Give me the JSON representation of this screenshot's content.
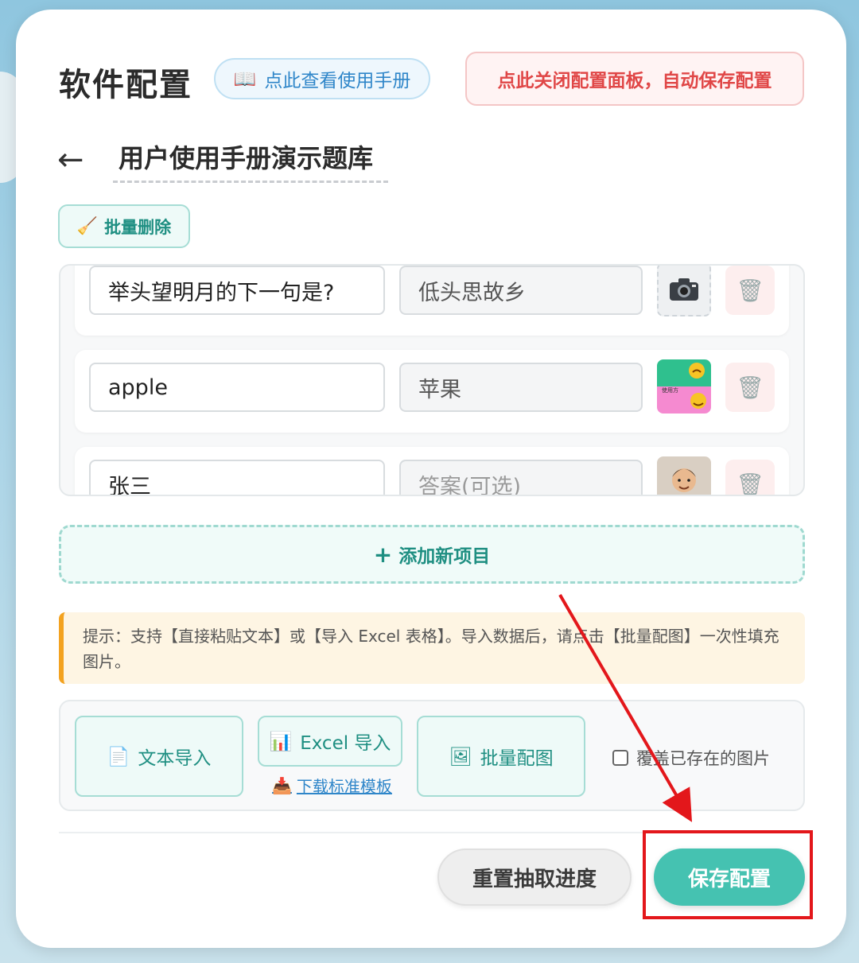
{
  "header": {
    "title": "软件配置",
    "manual_button": "点此查看使用手册",
    "close_button": "点此关闭配置面板，自动保存配置"
  },
  "deck": {
    "back_arrow": "←",
    "title": "用户使用手册演示题库"
  },
  "toolbar": {
    "batch_delete": "批量删除"
  },
  "items": [
    {
      "question": "举头望明月的下一句是?",
      "answer": "低头思故乡",
      "image": "camera-icon"
    },
    {
      "question": "apple",
      "answer": "苹果",
      "image": "sticker-thumbnail"
    },
    {
      "question": "张三",
      "answer": "",
      "answer_placeholder": "答案(可选)",
      "image": "avatar-thumbnail"
    }
  ],
  "thumb_text": "使用方",
  "add_button": "添加新项目",
  "tip": "提示：支持【直接粘贴文本】或【导入 Excel 表格】。导入数据后，请点击【批量配图】一次性填充图片。",
  "import": {
    "text_import": "文本导入",
    "excel_import": "Excel 导入",
    "download_template": "下载标准模板",
    "batch_image": "批量配图",
    "overwrite_label": "覆盖已存在的图片",
    "overwrite_checked": false
  },
  "footer": {
    "reset_button": "重置抽取进度",
    "save_button": "保存配置"
  },
  "colors": {
    "accent": "#45c2b1",
    "danger": "#e04747",
    "annotation": "#e3171b"
  }
}
